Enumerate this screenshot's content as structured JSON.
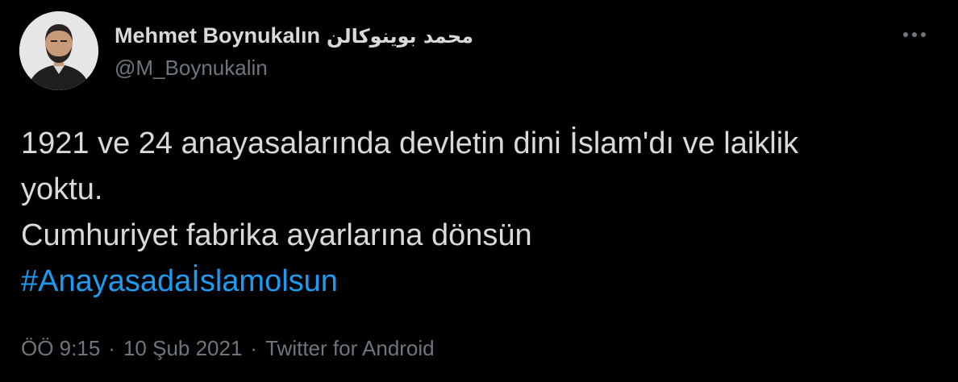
{
  "author": {
    "display_name": "Mehmet Boynukalın",
    "display_name_arabic": "محمد بوينوكالن",
    "handle": "@M_Boynukalin",
    "avatar_icon": "user-avatar"
  },
  "more_icon": "more-horizontal-icon",
  "tweet": {
    "lines": [
      "1921 ve 24 anayasalarında devletin dini İslam'dı ve laiklik",
      "yoktu.",
      "Cumhuriyet fabrika ayarlarına dönsün"
    ],
    "hashtag": "#Anayasadaİslamolsun"
  },
  "meta": {
    "time": "ÖÖ 9:15",
    "separator": "·",
    "date": "10 Şub 2021",
    "source": "Twitter for Android"
  },
  "colors": {
    "background": "#000000",
    "text": "#d9d9d9",
    "secondary": "#6e767d",
    "link": "#1d9bf0"
  }
}
